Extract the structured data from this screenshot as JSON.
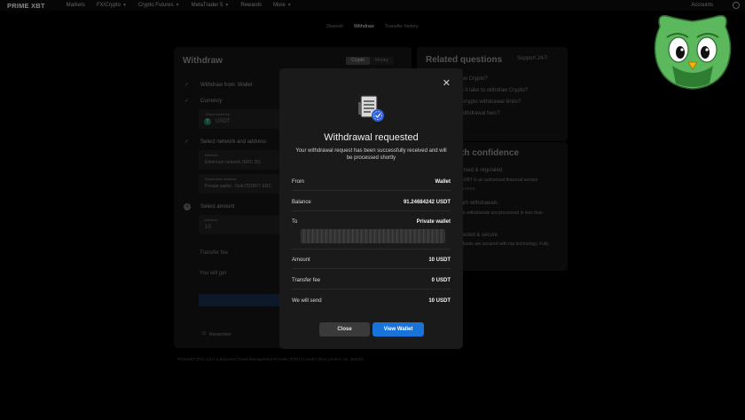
{
  "nav": {
    "logo": "PRIME XBT",
    "items": [
      {
        "label": "Markets",
        "dropdown": false
      },
      {
        "label": "FX/Crypto",
        "dropdown": true
      },
      {
        "label": "Crypto Futures",
        "dropdown": true
      },
      {
        "label": "MetaTrader 5",
        "dropdown": true
      },
      {
        "label": "Rewards",
        "dropdown": false
      },
      {
        "label": "More",
        "dropdown": true
      }
    ],
    "accounts": "Accounts"
  },
  "subtabs": {
    "deposit": "Deposit",
    "withdraw": "Withdraw",
    "transfer_history": "Transfer history"
  },
  "background": {
    "withdraw_title": "Withdraw",
    "toggle_crypto": "Crypto",
    "toggle_fiat": "Money",
    "withdraw_from": "Withdraw from: Wallet",
    "currency_label": "Currency",
    "currency_field_label": "Select currency",
    "currency_value": "USDT",
    "network_label": "Select network and address",
    "network_field_label": "Network",
    "network_value": "Ethereum network (ERC 20)",
    "address_field_label": "Destination address",
    "address_value": "Private wallet · 0xdc7D2BF7 ERC",
    "amount_label": "Select amount",
    "amount_field_label": "Amount",
    "amount_value": "10",
    "transfer_fee": "Transfer fee",
    "you_will_get": "You will get",
    "remember": "Remember",
    "footer": "PrimeXBT (PX) Ltd is a Business Travel Management Provider (FSP) in South Africa Limited, No. 483324",
    "related_title": "Related questions",
    "support": "Support 24/7",
    "q1": "How to withdraw Crypto?",
    "q2": "How long does it take to withdraw Crypto?",
    "q3": "Where are my crypto withdrawal limits?",
    "q4": "What are the withdrawal fees?",
    "confidence_title": "Trade with confidence",
    "c1_title": "Licensed & regulated",
    "c1_text": "PrimeXBT is an authorized financial service",
    "c1_link": "Learn more",
    "c2_title": "Instant withdrawals",
    "c2_text": "Crypto withdrawals are processed in less than",
    "c3_title": "Protected & secure",
    "c3_text": "Your funds are secured with top technology. Fully"
  },
  "modal": {
    "title": "Withdrawal requested",
    "subtitle": "Your withdrawal request has been successfully received and will be processed shortly",
    "rows": [
      {
        "label": "From",
        "value": "Wallet"
      },
      {
        "label": "Balance",
        "value": "91.24684242 USDT"
      },
      {
        "label": "To",
        "value": "Private wallet"
      },
      {
        "label": "Amount",
        "value": "10 USDT"
      },
      {
        "label": "Transfer fee",
        "value": "0 USDT"
      },
      {
        "label": "We will send",
        "value": "10 USDT"
      }
    ],
    "close_label": "Close",
    "view_label": "View Wallet"
  },
  "colors": {
    "accent": "#1a73d9",
    "modal_bg": "#1a1a1a",
    "mascot_green": "#5cb85c"
  },
  "icons": {
    "close": "close-icon",
    "document": "document-check-icon",
    "user": "user-icon"
  }
}
